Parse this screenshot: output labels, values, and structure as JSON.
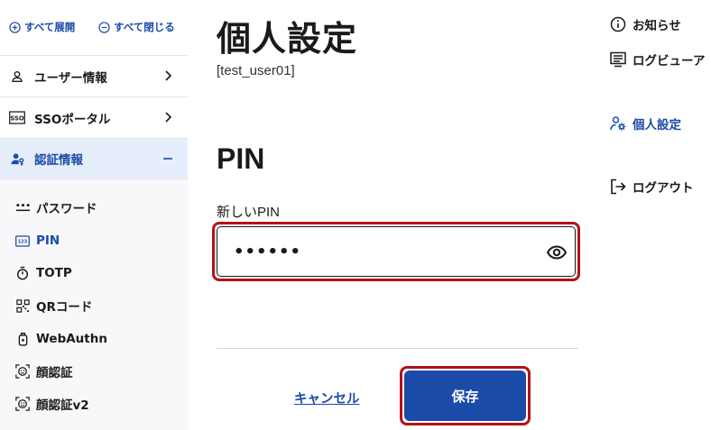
{
  "page": {
    "title": "個人設定",
    "user_id": "[test_user01]",
    "section_title": "PIN"
  },
  "sidebar": {
    "expand_all": "すべて展開",
    "collapse_all": "すべて閉じる",
    "items": [
      {
        "label": "ユーザー情報",
        "icon": "person-icon",
        "state": "collapsed"
      },
      {
        "label": "SSOポータル",
        "icon": "sso-icon",
        "state": "collapsed"
      },
      {
        "label": "認証情報",
        "icon": "user-key-icon",
        "state": "expanded"
      }
    ],
    "sub_items": [
      {
        "label": "パスワード",
        "icon": "password-dots-icon"
      },
      {
        "label": "PIN",
        "icon": "pin-pad-icon"
      },
      {
        "label": "TOTP",
        "icon": "stopwatch-icon"
      },
      {
        "label": "QRコード",
        "icon": "qr-code-icon"
      },
      {
        "label": "WebAuthn",
        "icon": "security-key-icon"
      },
      {
        "label": "顔認証",
        "icon": "face-icon"
      },
      {
        "label": "顔認証v2",
        "icon": "face-v2-icon"
      }
    ],
    "current_sub": "PIN"
  },
  "form": {
    "pin_label": "新しいPIN",
    "pin_value": "••••••",
    "cancel_label": "キャンセル",
    "save_label": "保存"
  },
  "right_nav": {
    "notice": "お知らせ",
    "log_viewer": "ログビューア",
    "personal": "個人設定",
    "logout": "ログアウト"
  },
  "colors": {
    "accent": "#1a4ba8",
    "highlight_outline": "#b2131a",
    "active_bg": "#e6eefb",
    "sidebar_bg": "#f8f8fb"
  }
}
